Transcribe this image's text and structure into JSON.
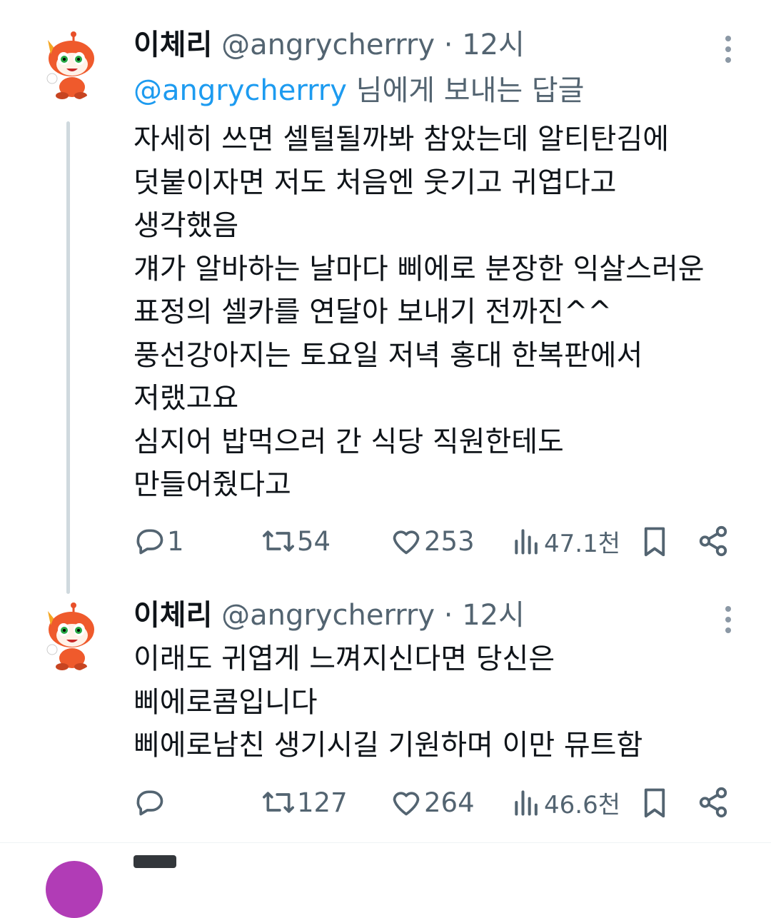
{
  "tweets": [
    {
      "name": "이체리",
      "handle": "@angrycherrry",
      "separator": "·",
      "time": "12시",
      "reply_to": {
        "mention": "@angrycherrry",
        "suffix": " 님에게 보내는 답글"
      },
      "lines": [
        "자세히 쓰면 셀털될까봐 참았는데 알티탄김에",
        "덧붙이자면 저도 처음엔 웃기고 귀엽다고",
        "생각했음",
        "걔가 알바하는 날마다 삐에로 분장한 익살스러운",
        "표정의 셀카를 연달아 보내기 전까진^^",
        "풍선강아지는 토요일 저녁 홍대 한복판에서",
        "저랬고요",
        "심지어 밥먹으러 간 식당 직원한테도",
        "만들어줬다고"
      ],
      "stats": {
        "replies": "1",
        "retweets": "54",
        "likes": "253",
        "views": "47.1천"
      }
    },
    {
      "name": "이체리",
      "handle": "@angrycherrry",
      "separator": "·",
      "time": "12시",
      "lines": [
        "이래도 귀엽게 느껴지신다면 당신은",
        "삐에로콤입니다",
        "삐에로남친 생기시길 기원하며 이만 뮤트함"
      ],
      "stats": {
        "replies": "",
        "retweets": "127",
        "likes": "264",
        "views": "46.6천"
      }
    }
  ],
  "icons": {
    "reply": "reply-icon",
    "retweet": "retweet-icon",
    "like": "heart-icon",
    "views": "views-chart-icon",
    "bookmark": "bookmark-icon",
    "share": "share-icon",
    "more": "more-vertical-icon"
  },
  "colors": {
    "accent": "#1d9bf0",
    "secondary_text": "#536471",
    "thread_line": "#cfd9de"
  }
}
